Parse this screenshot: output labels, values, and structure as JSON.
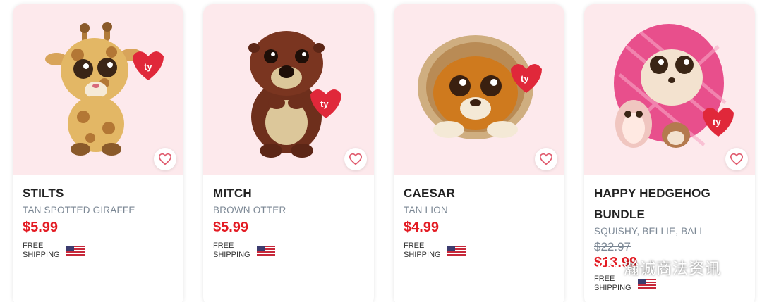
{
  "products": [
    {
      "name": "STILTS",
      "subtitle": "TAN SPOTTED GIRAFFE",
      "price": "$5.99",
      "shipping": "FREE SHIPPING",
      "image_icon": "giraffe-plush-image"
    },
    {
      "name": "MITCH",
      "subtitle": "BROWN OTTER",
      "price": "$5.99",
      "shipping": "FREE SHIPPING",
      "image_icon": "otter-plush-image"
    },
    {
      "name": "CAESAR",
      "subtitle": "TAN LION",
      "price": "$4.99",
      "shipping": "FREE SHIPPING",
      "image_icon": "lion-plush-image"
    },
    {
      "name": "HAPPY HEDGEHOG BUNDLE",
      "subtitle": "SQUISHY, BELLIE, BALL",
      "original_price": "$22.97",
      "price": "$13.99",
      "shipping": "FREE SHIPPING",
      "image_icon": "hedgehog-bundle-image"
    }
  ],
  "colors": {
    "card_image_bg": "#fde9ec",
    "price": "#e31b23",
    "subtitle": "#7b8794",
    "heart": "#e05a6d"
  },
  "watermark": {
    "text": "瀚诚商法资讯",
    "icon": "wechat-icon"
  }
}
